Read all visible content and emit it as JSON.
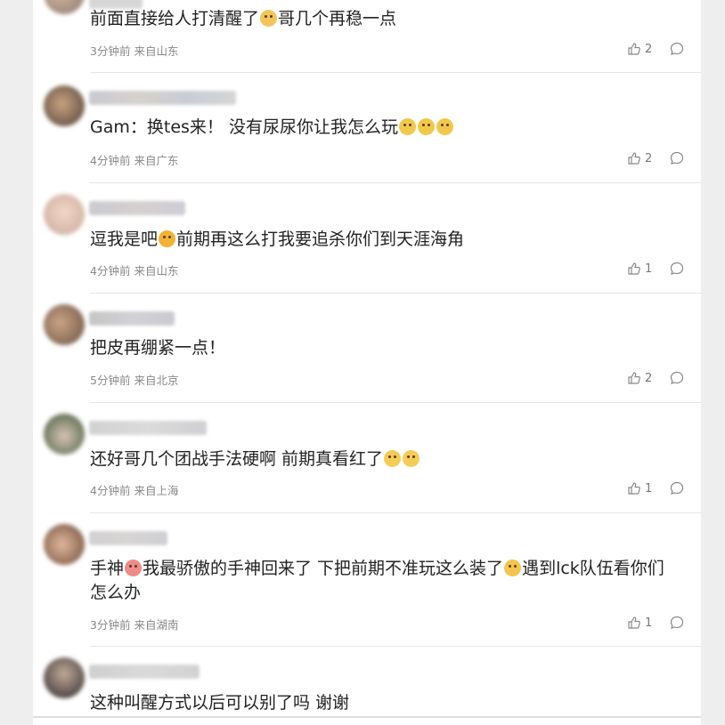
{
  "comments": [
    {
      "text": "前面直接给人打清醒了",
      "tail": "哥几个再稳一点",
      "time": "3分钟前",
      "location": "来自山东",
      "likes": "2",
      "emojis": [
        "cat-face-emoji"
      ]
    },
    {
      "text": "Gam：换tes来！  没有尿尿你让我怎么玩",
      "time": "4分钟前",
      "location": "来自广东",
      "likes": "2",
      "emojis": [
        "crying-face-emoji",
        "crying-face-emoji",
        "crying-face-emoji"
      ]
    },
    {
      "text": "逗我是吧",
      "tail": "前期再这么打我要追杀你们到天涯海角",
      "time": "4分钟前",
      "location": "来自山东",
      "likes": "1",
      "emojis": [
        "yum-face-emoji"
      ]
    },
    {
      "text": "把皮再绷紧一点！",
      "time": "5分钟前",
      "location": "来自北京",
      "likes": "2"
    },
    {
      "text": "还好哥几个团战手法硬啊 前期真看红了",
      "time": "4分钟前",
      "location": "来自上海",
      "likes": "1",
      "emojis": [
        "flushed-face-emoji",
        "flushed-face-emoji"
      ]
    },
    {
      "text": "手神",
      "mid": "我最骄傲的手神回来了 下把前期不准玩这么装了",
      "tail": "遇到lck队伍看你们",
      "line2": "怎么办",
      "time": "3分钟前",
      "location": "来自湖南",
      "likes": "1",
      "emojis": [
        "heart-eyes-emoji",
        "smirk-face-emoji"
      ]
    },
    {
      "text": "这种叫醒方式以后可以别了吗 谢谢"
    }
  ]
}
